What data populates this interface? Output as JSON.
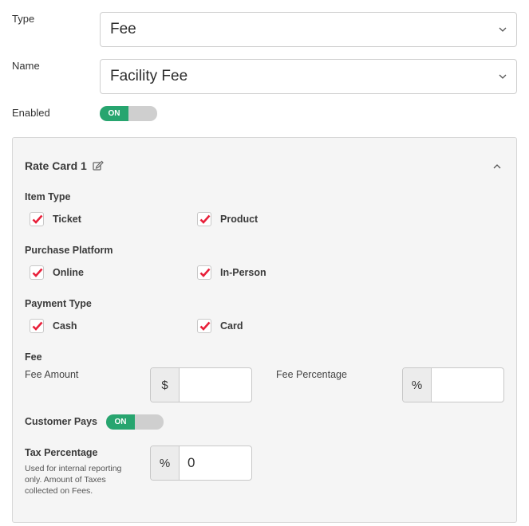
{
  "form": {
    "type": {
      "label": "Type",
      "value": "Fee"
    },
    "name": {
      "label": "Name",
      "value": "Facility Fee"
    },
    "enabled": {
      "label": "Enabled",
      "toggle_text": "ON",
      "state": true
    }
  },
  "rate_card": {
    "title": "Rate Card 1",
    "edit_icon": "edit-icon",
    "collapse_icon": "chevron-up-icon",
    "item_type": {
      "heading": "Item Type",
      "options": [
        {
          "label": "Ticket",
          "checked": true
        },
        {
          "label": "Product",
          "checked": true
        }
      ]
    },
    "purchase_platform": {
      "heading": "Purchase Platform",
      "options": [
        {
          "label": "Online",
          "checked": true
        },
        {
          "label": "In-Person",
          "checked": true
        }
      ]
    },
    "payment_type": {
      "heading": "Payment Type",
      "options": [
        {
          "label": "Cash",
          "checked": true
        },
        {
          "label": "Card",
          "checked": true
        }
      ]
    },
    "fee": {
      "heading": "Fee",
      "amount_label": "Fee Amount",
      "amount_addon": "$",
      "amount_value": "",
      "percentage_label": "Fee Percentage",
      "percentage_addon": "%",
      "percentage_value": ""
    },
    "customer_pays": {
      "label": "Customer Pays",
      "toggle_text": "ON",
      "state": true
    },
    "tax": {
      "label": "Tax Percentage",
      "help": "Used for internal reporting only. Amount of Taxes collected on Fees.",
      "addon": "%",
      "value": "0"
    }
  },
  "colors": {
    "accent_green": "#27a56f",
    "check_red": "#e8203a"
  }
}
